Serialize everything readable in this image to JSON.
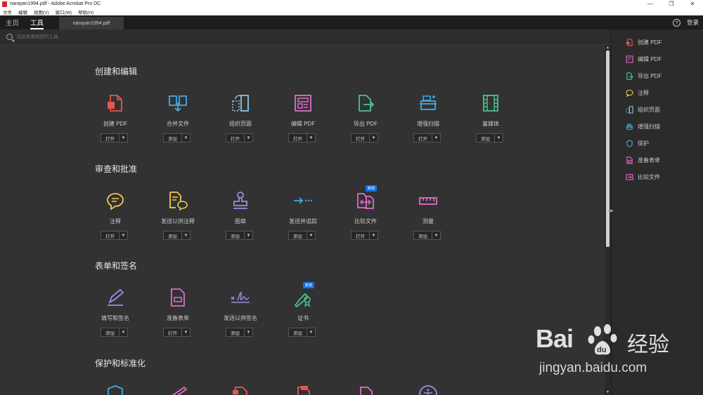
{
  "window": {
    "title": "narayan1994.pdf - Adobe Acrobat Pro DC",
    "controls": [
      "—",
      "❐",
      "✕"
    ]
  },
  "menu": [
    "文件",
    "编辑",
    "视图(V)",
    "窗口(W)",
    "帮助(H)"
  ],
  "tabs": {
    "home": "主页",
    "tools": "工具",
    "document": "narayan1994.pdf"
  },
  "header": {
    "help": "?",
    "login": "登录"
  },
  "search": {
    "placeholder": "在此处查找您的工具"
  },
  "sections": [
    {
      "title": "创建和编辑",
      "tools": [
        {
          "name": "创建 PDF",
          "button": "打开",
          "icon": "create-pdf-icon",
          "color": "#e8554e"
        },
        {
          "name": "合并文件",
          "button": "添加",
          "icon": "combine-files-icon",
          "color": "#4aa8e0"
        },
        {
          "name": "组织页面",
          "button": "打开",
          "icon": "organize-pages-icon",
          "color": "#8fc4e8"
        },
        {
          "name": "编辑 PDF",
          "button": "打开",
          "icon": "edit-pdf-icon",
          "color": "#e06cc8"
        },
        {
          "name": "导出 PDF",
          "button": "打开",
          "icon": "export-pdf-icon",
          "color": "#4cc18f"
        },
        {
          "name": "增强扫描",
          "button": "打开",
          "icon": "enhance-scan-icon",
          "color": "#3dabe8"
        },
        {
          "name": "富媒体",
          "button": "添加",
          "icon": "rich-media-icon",
          "color": "#4cc18f"
        }
      ]
    },
    {
      "title": "审查和批准",
      "tools": [
        {
          "name": "注释",
          "button": "打开",
          "icon": "comment-icon",
          "color": "#f2c94c"
        },
        {
          "name": "发送以供注释",
          "button": "添加",
          "icon": "send-for-comments-icon",
          "color": "#f2c94c"
        },
        {
          "name": "图章",
          "button": "添加",
          "icon": "stamp-icon",
          "color": "#9a8fe0"
        },
        {
          "name": "发送并追踪",
          "button": "添加",
          "icon": "send-track-icon",
          "color": "#4aa8e0"
        },
        {
          "name": "比较文件",
          "button": "打开",
          "icon": "compare-files-icon",
          "color": "#e06cc8",
          "badge": "新增"
        },
        {
          "name": "测量",
          "button": "添加",
          "icon": "measure-icon",
          "color": "#e06cc8"
        }
      ]
    },
    {
      "title": "表单和签名",
      "tools": [
        {
          "name": "填写和签名",
          "button": "添加",
          "icon": "fill-sign-icon",
          "color": "#9a8fe0"
        },
        {
          "name": "准备表单",
          "button": "打开",
          "icon": "prepare-form-icon",
          "color": "#e06cc8"
        },
        {
          "name": "发送以供签名",
          "button": "添加",
          "icon": "send-for-signature-icon",
          "color": "#9a8fe0"
        },
        {
          "name": "证书",
          "button": "添加",
          "icon": "certificate-icon",
          "color": "#4cc18f",
          "badge": "新增"
        }
      ]
    },
    {
      "title": "保护和标准化",
      "tools": []
    }
  ],
  "right_panel": [
    {
      "name": "创建 PDF",
      "icon": "create-pdf-icon",
      "color": "#e8554e"
    },
    {
      "name": "编辑 PDF",
      "icon": "edit-pdf-icon",
      "color": "#e06cc8"
    },
    {
      "name": "导出 PDF",
      "icon": "export-pdf-icon",
      "color": "#4cc18f"
    },
    {
      "name": "注释",
      "icon": "comment-icon",
      "color": "#f2c94c"
    },
    {
      "name": "组织页面",
      "icon": "organize-pages-icon",
      "color": "#8fc4e8"
    },
    {
      "name": "增强扫描",
      "icon": "enhance-scan-icon",
      "color": "#3dabe8"
    },
    {
      "name": "保护",
      "icon": "protect-icon",
      "color": "#4aa8e0"
    },
    {
      "name": "准备表单",
      "icon": "prepare-form-icon",
      "color": "#e06cc8"
    },
    {
      "name": "比较文件",
      "icon": "compare-files-icon",
      "color": "#e06cc8"
    }
  ],
  "watermark": {
    "brand": "Bai",
    "brand2": "du",
    "cn": "经验",
    "url": "jingyan.baidu.com"
  }
}
